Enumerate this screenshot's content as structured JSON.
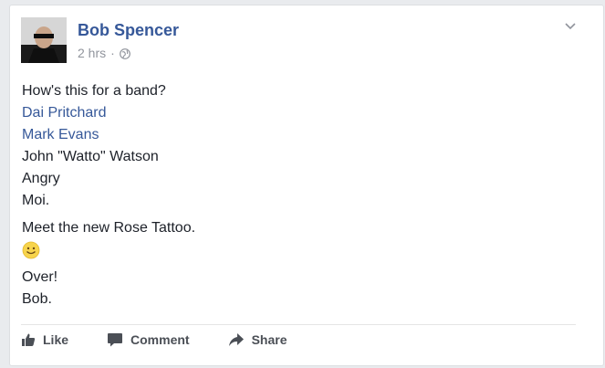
{
  "post": {
    "author": "Bob Spencer",
    "time": "2 hrs",
    "separator": "·",
    "lines": {
      "l1": "How's this for a band?",
      "l2": "Dai Pritchard",
      "l3": "Mark Evans",
      "l4": "John \"Watto\" Watson",
      "l5": "Angry",
      "l6": "Moi.",
      "l7": "Meet the new Rose Tattoo.",
      "l8": "Over!",
      "l9": "Bob."
    }
  },
  "actions": {
    "like": "Like",
    "comment": "Comment",
    "share": "Share"
  },
  "icons": {
    "privacy": "globe-icon",
    "menu": "chevron-down-icon",
    "emoji": "smiley-icon",
    "like": "thumbs-up-icon",
    "comment": "comment-icon",
    "share": "share-arrow-icon"
  },
  "colors": {
    "link": "#365899",
    "text": "#1d2129",
    "meta": "#90949c",
    "action": "#4b4f56",
    "page_bg": "#e9ebee"
  }
}
